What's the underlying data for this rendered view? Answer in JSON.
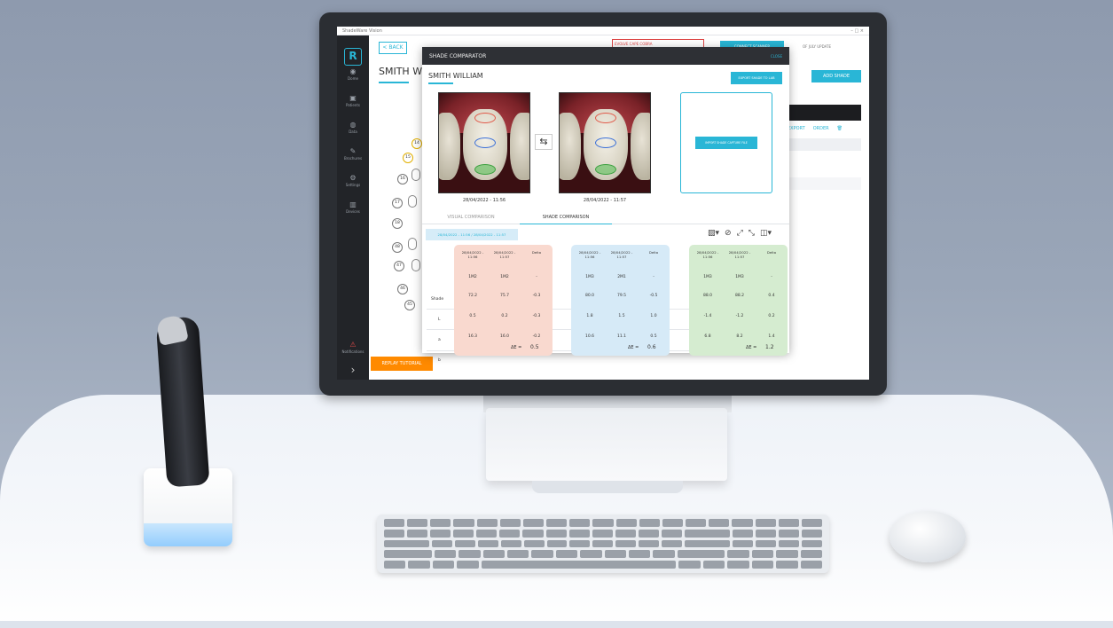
{
  "app": {
    "window_title": "ShadeWare Vision",
    "window_controls": "–  □  ×",
    "logo_letter": "R"
  },
  "nav": [
    {
      "icon": "◉",
      "label": "Dome"
    },
    {
      "icon": "▣",
      "label": "Patients"
    },
    {
      "icon": "◍",
      "label": "Data"
    },
    {
      "icon": "✎",
      "label": "Brochures"
    },
    {
      "icon": "⚙",
      "label": "Settings"
    },
    {
      "icon": "▥",
      "label": "Devices"
    },
    {
      "icon": "⚠",
      "label": "Notifications"
    }
  ],
  "background": {
    "back_label": "< BACK",
    "patient_name": "SMITH WIL",
    "badge_text": "EVOLVE CAPE COBRA",
    "top_button": "CONNECT SCANNER",
    "top_right": "OF JULY UPDATE",
    "add_button": "ADD SHADE",
    "actions": [
      "EXPORT",
      "ORDER"
    ],
    "replay_label": "REPLAY TUTORIAL",
    "tooth_numbers": [
      "14",
      "15",
      "16",
      "17",
      "18",
      "48",
      "47",
      "46",
      "45"
    ]
  },
  "modal": {
    "title": "SHADE COMPARATOR",
    "close": "CLOSE",
    "patient": "SMITH WILLIAM",
    "export_button": "EXPORT SHADE TO LAB",
    "import_button": "IMPORT SHADE CAPTURE FILE",
    "photo_dates": [
      "28/04/2022 - 11:56",
      "28/04/2022 - 11:57"
    ],
    "tabs": [
      "VISUAL COMPARISON",
      "SHADE COMPARISON"
    ],
    "date_pill": "28/04/2022 - 11:56 / 28/04/2022 - 11:57",
    "row_labels": [
      "Shade",
      "L",
      "a",
      "b"
    ],
    "col_headers": [
      "28/04/2022 - 11:56",
      "28/04/2022 - 11:57",
      "Delta"
    ],
    "de_label": "ΔE =",
    "cards": [
      {
        "rows": [
          [
            "1M2",
            "1M2",
            "-"
          ],
          [
            "72.2",
            "75.7",
            "-0.3"
          ],
          [
            "0.5",
            "0.2",
            "-0.3"
          ],
          [
            "16.3",
            "16.0",
            "-0.2"
          ]
        ],
        "de": "0.5"
      },
      {
        "rows": [
          [
            "1M3",
            "2M1",
            "-"
          ],
          [
            "80.0",
            "79.5",
            "-0.5"
          ],
          [
            "1.8",
            "1.5",
            "1.0"
          ],
          [
            "10.6",
            "11.1",
            "0.5"
          ]
        ],
        "de": "0.6"
      },
      {
        "rows": [
          [
            "1M3",
            "1M3",
            "-"
          ],
          [
            "88.0",
            "88.2",
            "0.4"
          ],
          [
            "-1.4",
            "-1.2",
            "0.2"
          ],
          [
            "6.8",
            "8.2",
            "1.4"
          ]
        ],
        "de": "1.2"
      }
    ]
  },
  "colors": {
    "accent": "#29b6d6",
    "replay": "#ff8a00",
    "card_red": "#f9d9cf",
    "card_blue": "#d6eaf7",
    "card_green": "#d5ecd0"
  }
}
